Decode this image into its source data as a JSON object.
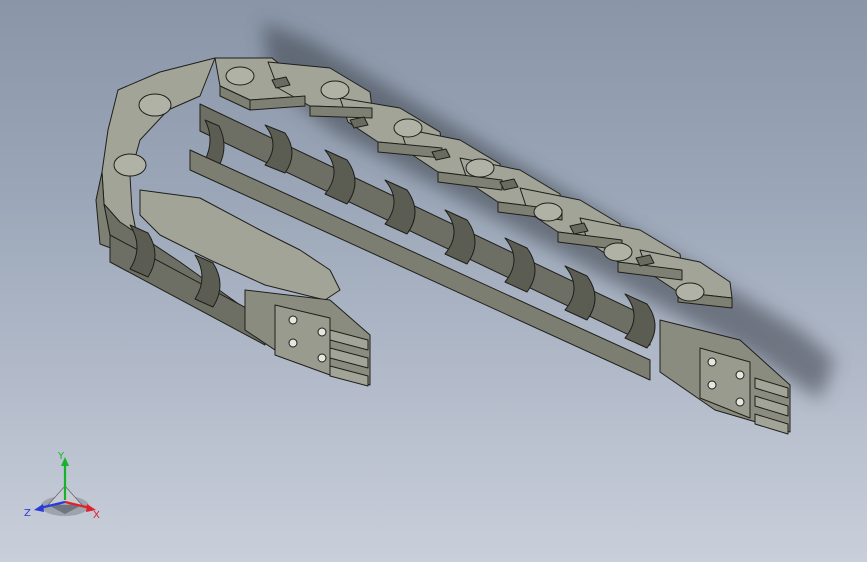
{
  "viewport": {
    "background_top": "#8a96a8",
    "background_bottom": "#c9cfda"
  },
  "model": {
    "part": "cable-carrier-drag-chain",
    "body_color": "#8b8c80",
    "top_color": "#a3a498",
    "dark_color": "#5b5c52",
    "edge_color": "#1f1f1a",
    "pin_color": "#e6e6e0"
  },
  "triad": {
    "y_label": "Y",
    "x_label": "X",
    "z_label": "Z",
    "y_color": "#16b22a",
    "x_color": "#e0202a",
    "z_color": "#2a3ad8"
  }
}
